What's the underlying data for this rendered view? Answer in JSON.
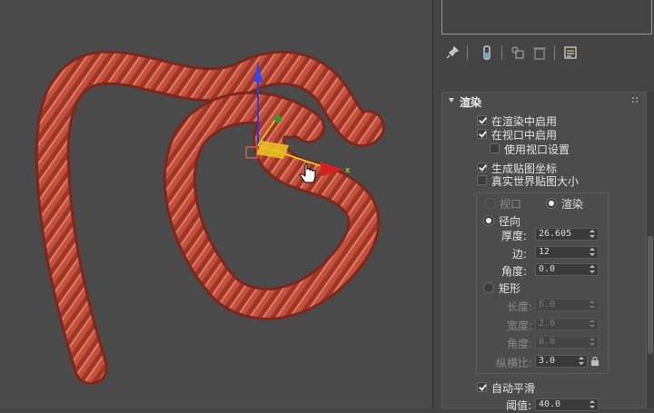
{
  "viewport": {
    "label": "3D viewport - rope spline object",
    "gizmo_x_label": "x"
  },
  "toolbar": {
    "icons": [
      "pin-icon",
      "modifier-stack-icon",
      "make-unique-icon",
      "delete-modifier-icon",
      "configure-modifier-sets-icon"
    ]
  },
  "rendering": {
    "title": "渲染",
    "enable_in_renderer": {
      "label": "在渲染中启用",
      "checked": true
    },
    "enable_in_viewport": {
      "label": "在视口中启用",
      "checked": true
    },
    "use_viewport_settings": {
      "label": "使用视口设置",
      "checked": false
    },
    "generate_mapping_coords": {
      "label": "生成贴图坐标",
      "checked": true
    },
    "real_world_map_size": {
      "label": "真实世界贴图大小",
      "checked": false
    },
    "mode_viewport": "视口",
    "mode_render": "渲染",
    "radial": {
      "label": "径向",
      "thickness_label": "厚度:",
      "thickness": "26.605",
      "sides_label": "边:",
      "sides": "12",
      "angle_label": "角度:",
      "angle": "0.0"
    },
    "rectangular": {
      "label": "矩形",
      "length_label": "长度:",
      "length": "6.0",
      "width_label": "宽度:",
      "width": "2.0",
      "angle_label": "角度:",
      "angle": "0.0",
      "aspect_label": "纵横比:",
      "aspect": "3.0"
    },
    "auto_smooth": {
      "label": "自动平滑",
      "checked": true
    },
    "threshold_label": "阈值:",
    "threshold": "40.0"
  },
  "colors": {
    "rope": "#c9523f",
    "rope_dark": "#8a2e22",
    "rope_light": "#e07a63",
    "gizmo_y": "#e8e020",
    "gizmo_x": "#d82020",
    "gizmo_z": "#2040e0"
  }
}
